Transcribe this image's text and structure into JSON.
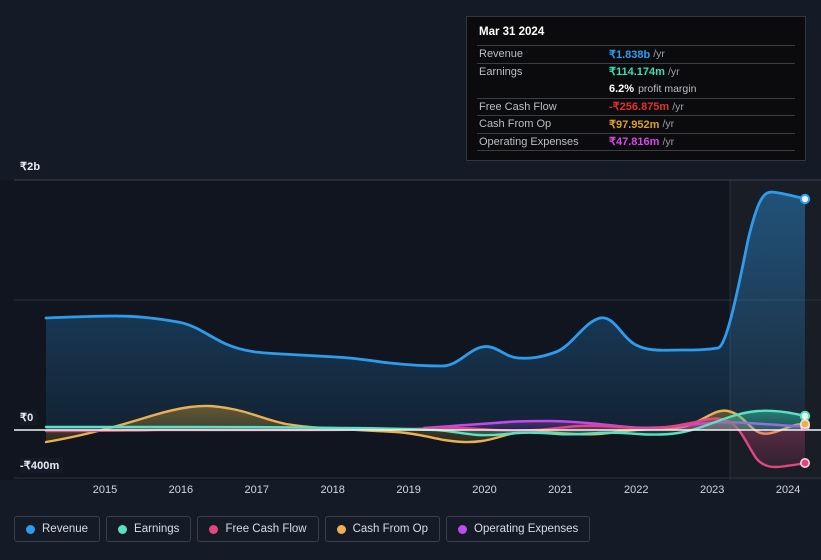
{
  "chart_data": {
    "type": "area",
    "title": "",
    "xlabel": "",
    "ylabel": "",
    "currency": "₹",
    "grid": true,
    "legend_position": "bottom",
    "ylim": [
      -400000000,
      2000000000
    ],
    "y_ticks": [
      {
        "label": "₹2b",
        "value": 2000000000
      },
      {
        "label": "₹0",
        "value": 0
      },
      {
        "label": "-₹400m",
        "value": -400000000
      }
    ],
    "x_ticks": [
      "2015",
      "2016",
      "2017",
      "2018",
      "2019",
      "2020",
      "2021",
      "2022",
      "2023",
      "2024"
    ],
    "highlight_band": {
      "from": "2023.1",
      "label": "forecast-region"
    },
    "series": [
      {
        "name": "Revenue",
        "color": "#2e9ced",
        "values": [
          1005,
          1010,
          1000,
          930,
          880,
          860,
          845,
          800,
          760,
          735,
          720,
          735,
          790,
          745,
          700,
          720,
          760,
          1000,
          800,
          790,
          790,
          1838,
          1780
        ]
      },
      {
        "name": "Earnings",
        "color": "#5ae0c3",
        "values": [
          10,
          12,
          10,
          8,
          8,
          7,
          6,
          6,
          5,
          5,
          -20,
          -35,
          -28,
          -10,
          5,
          -15,
          -30,
          5,
          30,
          120,
          150,
          140,
          114.174
        ]
      },
      {
        "name": "Free Cash Flow",
        "color": "#e0467f",
        "values": [
          -5,
          -4,
          -3,
          -2,
          -2,
          -1,
          0,
          1,
          1,
          2,
          20,
          32,
          26,
          15,
          45,
          28,
          12,
          60,
          90,
          -280,
          -360,
          -300,
          -256.875
        ]
      },
      {
        "name": "Cash From Op",
        "color": "#eab054",
        "values": [
          -170,
          -120,
          -60,
          10,
          70,
          95,
          80,
          45,
          18,
          8,
          -30,
          -65,
          -55,
          -20,
          35,
          18,
          -10,
          110,
          150,
          60,
          5,
          60,
          97.952
        ]
      },
      {
        "name": "Operating Expenses",
        "color": "#c04af0",
        "values": [
          null,
          null,
          null,
          null,
          null,
          null,
          null,
          null,
          null,
          null,
          35,
          40,
          45,
          48,
          52,
          60,
          55,
          48,
          45,
          42,
          44,
          46,
          47.816
        ]
      }
    ]
  },
  "tooltip": {
    "title": "Mar 31 2024",
    "rows": [
      {
        "key": "Revenue",
        "value": "₹1.838b",
        "unit": "/yr",
        "color": "#2e9ced"
      },
      {
        "key": "Earnings",
        "value": "₹114.174m",
        "unit": "/yr",
        "color": "#3ddcb4"
      },
      {
        "key": "",
        "value": "6.2%",
        "unit": "",
        "sub": "profit margin",
        "color": "#ffffff"
      },
      {
        "key": "Free Cash Flow",
        "value": "-₹256.875m",
        "unit": "/yr",
        "color": "#e03131"
      },
      {
        "key": "Cash From Op",
        "value": "₹97.952m",
        "unit": "/yr",
        "color": "#d9a227"
      },
      {
        "key": "Operating Expenses",
        "value": "₹47.816m",
        "unit": "/yr",
        "color": "#d44ae8"
      }
    ]
  },
  "y_axis": {
    "top": "₹2b",
    "zero": "₹0",
    "bottom": "-₹400m"
  },
  "x_axis": {
    "labels": [
      "2015",
      "2016",
      "2017",
      "2018",
      "2019",
      "2020",
      "2021",
      "2022",
      "2023",
      "2024"
    ]
  },
  "legend": {
    "items": [
      {
        "label": "Revenue",
        "color": "#2e9ced"
      },
      {
        "label": "Earnings",
        "color": "#5ae0c3"
      },
      {
        "label": "Free Cash Flow",
        "color": "#e0467f"
      },
      {
        "label": "Cash From Op",
        "color": "#eab054"
      },
      {
        "label": "Operating Expenses",
        "color": "#c04af0"
      }
    ]
  }
}
